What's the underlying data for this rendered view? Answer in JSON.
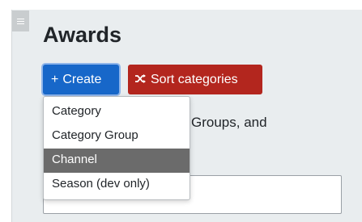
{
  "page": {
    "title": "Awards"
  },
  "toolbar": {
    "create_icon": "+",
    "create_label": "Create",
    "sort_icon": "shuffle-icon",
    "sort_label": "Sort categories"
  },
  "description_fragment": "Groups, and",
  "create_menu": {
    "items": [
      {
        "label": "Category",
        "active": false
      },
      {
        "label": "Category Group",
        "active": false
      },
      {
        "label": "Channel",
        "active": true
      },
      {
        "label": "Season (dev only)",
        "active": false
      }
    ]
  },
  "colors": {
    "create_button": "#1767c9",
    "sort_button": "#b3261e",
    "menu_highlight": "#6b6b6b",
    "panel_background": "#e9edef"
  }
}
